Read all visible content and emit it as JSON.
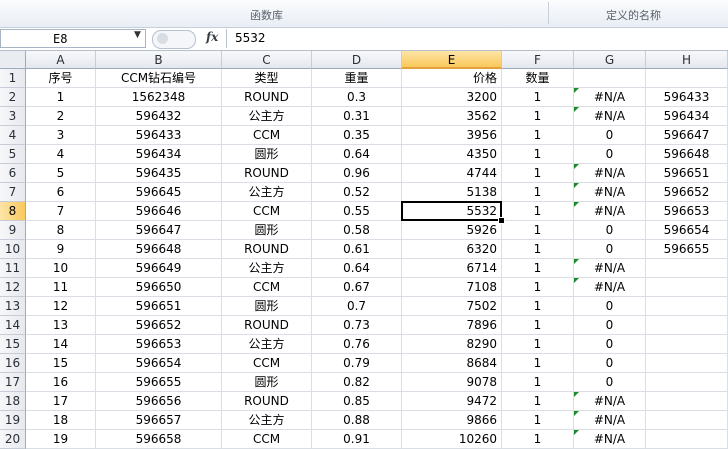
{
  "ribbon": {
    "groups": [
      {
        "label": "函数库"
      },
      {
        "label": "定义的名称"
      }
    ]
  },
  "formula_bar": {
    "name_box": "E8",
    "formula": "5532"
  },
  "columns": [
    "A",
    "B",
    "C",
    "D",
    "E",
    "F",
    "G",
    "H"
  ],
  "selected_column": "E",
  "selected_row": 8,
  "rows": [
    {
      "n": "1",
      "cells": [
        "序号",
        "CCM钻石编号",
        "类型",
        "重量",
        "价格",
        "数量",
        "",
        ""
      ],
      "tri": false
    },
    {
      "n": "2",
      "cells": [
        "1",
        "1562348",
        "ROUND",
        "0.3",
        "3200",
        "1",
        "#N/A",
        "596433"
      ],
      "tri": true
    },
    {
      "n": "3",
      "cells": [
        "2",
        "596432",
        "公主方",
        "0.31",
        "3562",
        "1",
        "#N/A",
        "596434"
      ],
      "tri": true
    },
    {
      "n": "4",
      "cells": [
        "3",
        "596433",
        "CCM",
        "0.35",
        "3956",
        "1",
        "0",
        "596647"
      ],
      "tri": false
    },
    {
      "n": "5",
      "cells": [
        "4",
        "596434",
        "圆形",
        "0.64",
        "4350",
        "1",
        "0",
        "596648"
      ],
      "tri": false
    },
    {
      "n": "6",
      "cells": [
        "5",
        "596435",
        "ROUND",
        "0.96",
        "4744",
        "1",
        "#N/A",
        "596651"
      ],
      "tri": true
    },
    {
      "n": "7",
      "cells": [
        "6",
        "596645",
        "公主方",
        "0.52",
        "5138",
        "1",
        "#N/A",
        "596652"
      ],
      "tri": true
    },
    {
      "n": "8",
      "cells": [
        "7",
        "596646",
        "CCM",
        "0.55",
        "5532",
        "1",
        "#N/A",
        "596653"
      ],
      "tri": true
    },
    {
      "n": "9",
      "cells": [
        "8",
        "596647",
        "圆形",
        "0.58",
        "5926",
        "1",
        "0",
        "596654"
      ],
      "tri": false
    },
    {
      "n": "10",
      "cells": [
        "9",
        "596648",
        "ROUND",
        "0.61",
        "6320",
        "1",
        "0",
        "596655"
      ],
      "tri": false
    },
    {
      "n": "11",
      "cells": [
        "10",
        "596649",
        "公主方",
        "0.64",
        "6714",
        "1",
        "#N/A",
        ""
      ],
      "tri": true
    },
    {
      "n": "12",
      "cells": [
        "11",
        "596650",
        "CCM",
        "0.67",
        "7108",
        "1",
        "#N/A",
        ""
      ],
      "tri": true
    },
    {
      "n": "13",
      "cells": [
        "12",
        "596651",
        "圆形",
        "0.7",
        "7502",
        "1",
        "0",
        ""
      ],
      "tri": false
    },
    {
      "n": "14",
      "cells": [
        "13",
        "596652",
        "ROUND",
        "0.73",
        "7896",
        "1",
        "0",
        ""
      ],
      "tri": false
    },
    {
      "n": "15",
      "cells": [
        "14",
        "596653",
        "公主方",
        "0.76",
        "8290",
        "1",
        "0",
        ""
      ],
      "tri": false
    },
    {
      "n": "16",
      "cells": [
        "15",
        "596654",
        "CCM",
        "0.79",
        "8684",
        "1",
        "0",
        ""
      ],
      "tri": false
    },
    {
      "n": "17",
      "cells": [
        "16",
        "596655",
        "圆形",
        "0.82",
        "9078",
        "1",
        "0",
        ""
      ],
      "tri": false
    },
    {
      "n": "18",
      "cells": [
        "17",
        "596656",
        "ROUND",
        "0.85",
        "9472",
        "1",
        "#N/A",
        ""
      ],
      "tri": true
    },
    {
      "n": "19",
      "cells": [
        "18",
        "596657",
        "公主方",
        "0.88",
        "9866",
        "1",
        "#N/A",
        ""
      ],
      "tri": true
    },
    {
      "n": "20",
      "cells": [
        "19",
        "596658",
        "CCM",
        "0.91",
        "10260",
        "1",
        "#N/A",
        ""
      ],
      "tri": true
    }
  ]
}
